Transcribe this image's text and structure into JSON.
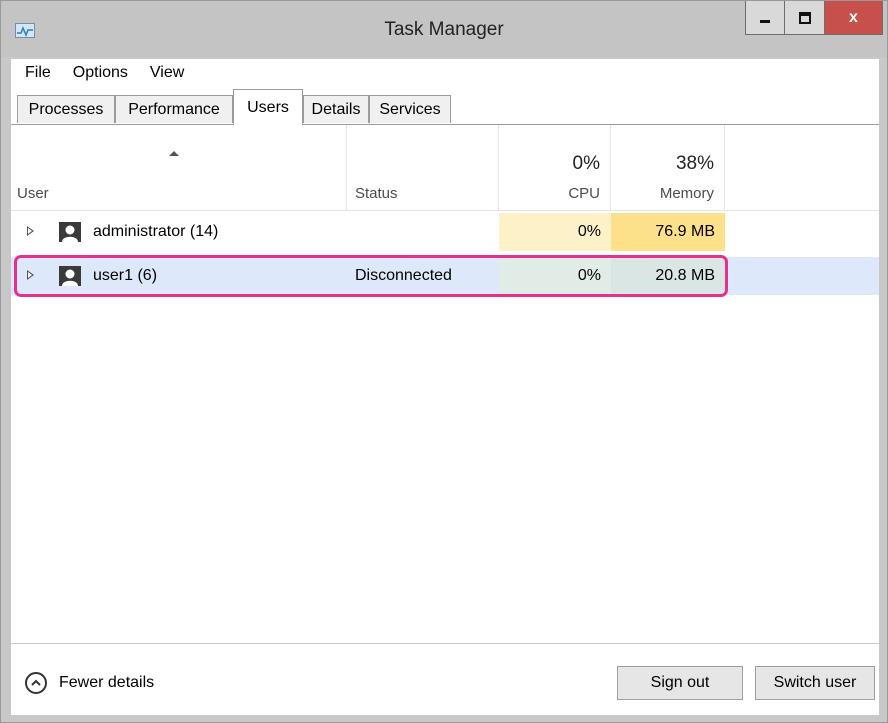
{
  "window": {
    "title": "Task Manager",
    "minimize_label": "minimize",
    "maximize_label": "maximize",
    "close_label": "x"
  },
  "menu": [
    "File",
    "Options",
    "View"
  ],
  "tabs": [
    {
      "label": "Processes",
      "active": false
    },
    {
      "label": "Performance",
      "active": false
    },
    {
      "label": "Users",
      "active": true
    },
    {
      "label": "Details",
      "active": false
    },
    {
      "label": "Services",
      "active": false
    }
  ],
  "columns": {
    "user": "User",
    "status": "Status",
    "cpu": {
      "label": "CPU",
      "total": "0%"
    },
    "memory": {
      "label": "Memory",
      "total": "38%"
    }
  },
  "rows": [
    {
      "name": "administrator (14)",
      "status": "",
      "cpu": "0%",
      "memory": "76.9 MB",
      "selected": false
    },
    {
      "name": "user1 (6)",
      "status": "Disconnected",
      "cpu": "0%",
      "memory": "20.8 MB",
      "selected": true
    }
  ],
  "footer": {
    "fewer_details": "Fewer details",
    "sign_out": "Sign out",
    "switch_user": "Switch user"
  },
  "colors": {
    "highlight": "#e6308c",
    "cpu_heat": "#fdf1c7",
    "memory_heat": "#fce08a",
    "selected_row": "#d9e6fa"
  }
}
